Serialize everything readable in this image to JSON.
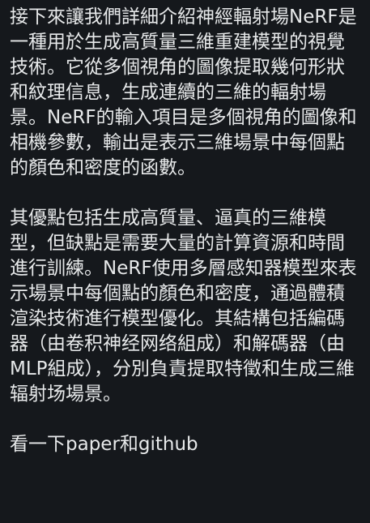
{
  "post": {
    "paragraph_1": "接下來讓我們詳細介紹神經輻射場NeRF是一種用於生成高質量三維重建模型的視覺技術。它從多個視角的圖像提取幾何形狀和紋理信息，生成連續的三維的輻射場景。NeRF的輸入項目是多個視角的圖像和相機參數，輸出是表示三維場景中每個點的顏色和密度的函數。",
    "paragraph_2": "其優點包括生成高質量、逼真的三維模型，但缺點是需要大量的計算資源和時間進行訓練。NeRF使用多層感知器模型來表示場景中每個點的顏色和密度，通過體積渲染技術進行模型優化。其結構包括編碼器（由卷积神经网络組成）和解碼器（由MLP組成），分別負責提取特徵和生成三維辐射场場景。",
    "paragraph_3": "看一下paper和github"
  },
  "colors": {
    "background": "#15181c",
    "text": "#e7e9ea"
  }
}
